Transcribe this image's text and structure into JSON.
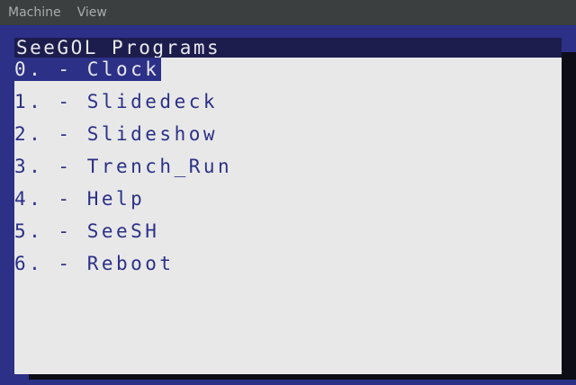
{
  "menubar": {
    "items": [
      {
        "label": "Machine"
      },
      {
        "label": "View"
      }
    ]
  },
  "window": {
    "title": "SeeGOL Programs",
    "selected_index": 0,
    "programs": [
      {
        "label": "0. - Clock"
      },
      {
        "label": "1. - Slidedeck"
      },
      {
        "label": "2. - Slideshow"
      },
      {
        "label": "3. - Trench_Run"
      },
      {
        "label": "4. - Help"
      },
      {
        "label": "5. - SeeSH"
      },
      {
        "label": "6. - Reboot"
      }
    ]
  },
  "colors": {
    "background": "#2c3087",
    "window": "#e8e8e8",
    "title_bar": "#1c1d4d",
    "text": "#2c3087",
    "menubar": "#3b3f3f"
  }
}
